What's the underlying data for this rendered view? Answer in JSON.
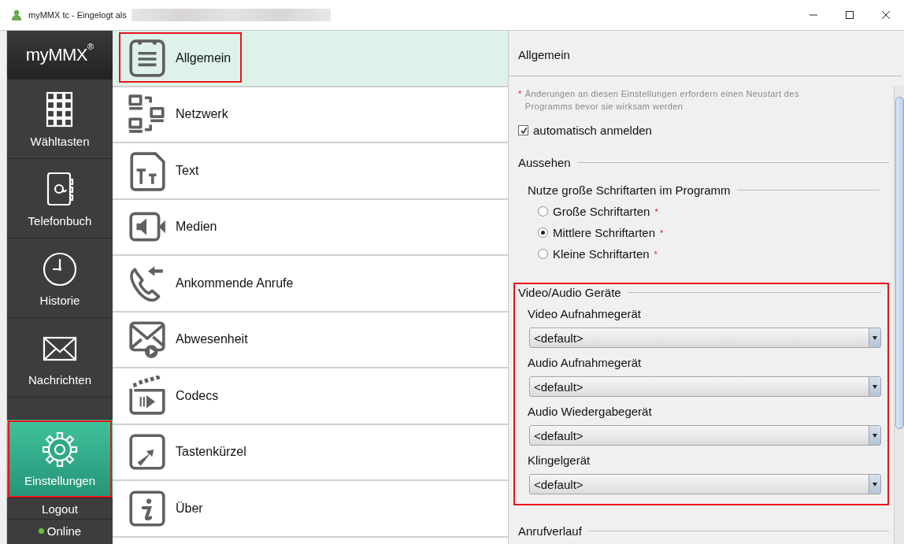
{
  "window": {
    "title": "myMMX tc - Eingelogt als"
  },
  "sidebar": {
    "logo": {
      "text": "myMMX",
      "mark": "®"
    },
    "items": [
      {
        "label": "Wähltasten",
        "selected": false,
        "highlighted": false
      },
      {
        "label": "Telefonbuch",
        "selected": false,
        "highlighted": false
      },
      {
        "label": "Historie",
        "selected": false,
        "highlighted": false
      },
      {
        "label": "Nachrichten",
        "selected": false,
        "highlighted": false
      },
      {
        "label": "Einstellungen",
        "selected": true,
        "highlighted": true
      }
    ],
    "logout": "Logout",
    "status": {
      "label": "Online",
      "online": true
    }
  },
  "categories": [
    {
      "label": "Allgemein",
      "selected": true,
      "highlighted": true
    },
    {
      "label": "Netzwerk",
      "selected": false,
      "highlighted": false
    },
    {
      "label": "Text",
      "selected": false,
      "highlighted": false
    },
    {
      "label": "Medien",
      "selected": false,
      "highlighted": false
    },
    {
      "label": "Ankommende Anrufe",
      "selected": false,
      "highlighted": false
    },
    {
      "label": "Abwesenheit",
      "selected": false,
      "highlighted": false
    },
    {
      "label": "Codecs",
      "selected": false,
      "highlighted": false
    },
    {
      "label": "Tastenkürzel",
      "selected": false,
      "highlighted": false
    },
    {
      "label": "Über",
      "selected": false,
      "highlighted": false
    }
  ],
  "settings": {
    "title": "Allgemein",
    "note": {
      "marker": "*",
      "text": "Änderungen an diesen Einstellungen erfordern einen Neustart des Programms bevor sie wirksam werden"
    },
    "auto_login": {
      "label": "automatisch anmelden",
      "checked": true
    },
    "sections": [
      {
        "title": "Aussehen",
        "highlighted": false,
        "groups": [
          {
            "title": "Nutze große Schriftarten im Programm",
            "options": [
              {
                "label": "Große Schriftarten",
                "selected": false,
                "marker": "*"
              },
              {
                "label": "Mittlere Schriftarten",
                "selected": true,
                "marker": "*"
              },
              {
                "label": "Kleine Schriftarten",
                "selected": false,
                "marker": "*"
              }
            ]
          }
        ]
      },
      {
        "title": "Video/Audio Geräte",
        "highlighted": true,
        "devices": [
          {
            "label": "Video Aufnahmegerät",
            "value": "<default>"
          },
          {
            "label": "Audio Aufnahmegerät",
            "value": "<default>"
          },
          {
            "label": "Audio Wiedergabegerät",
            "value": "<default>"
          },
          {
            "label": "Klingelgerät",
            "value": "<default>"
          }
        ]
      },
      {
        "title": "Anrufverlauf",
        "highlighted": false
      }
    ]
  }
}
